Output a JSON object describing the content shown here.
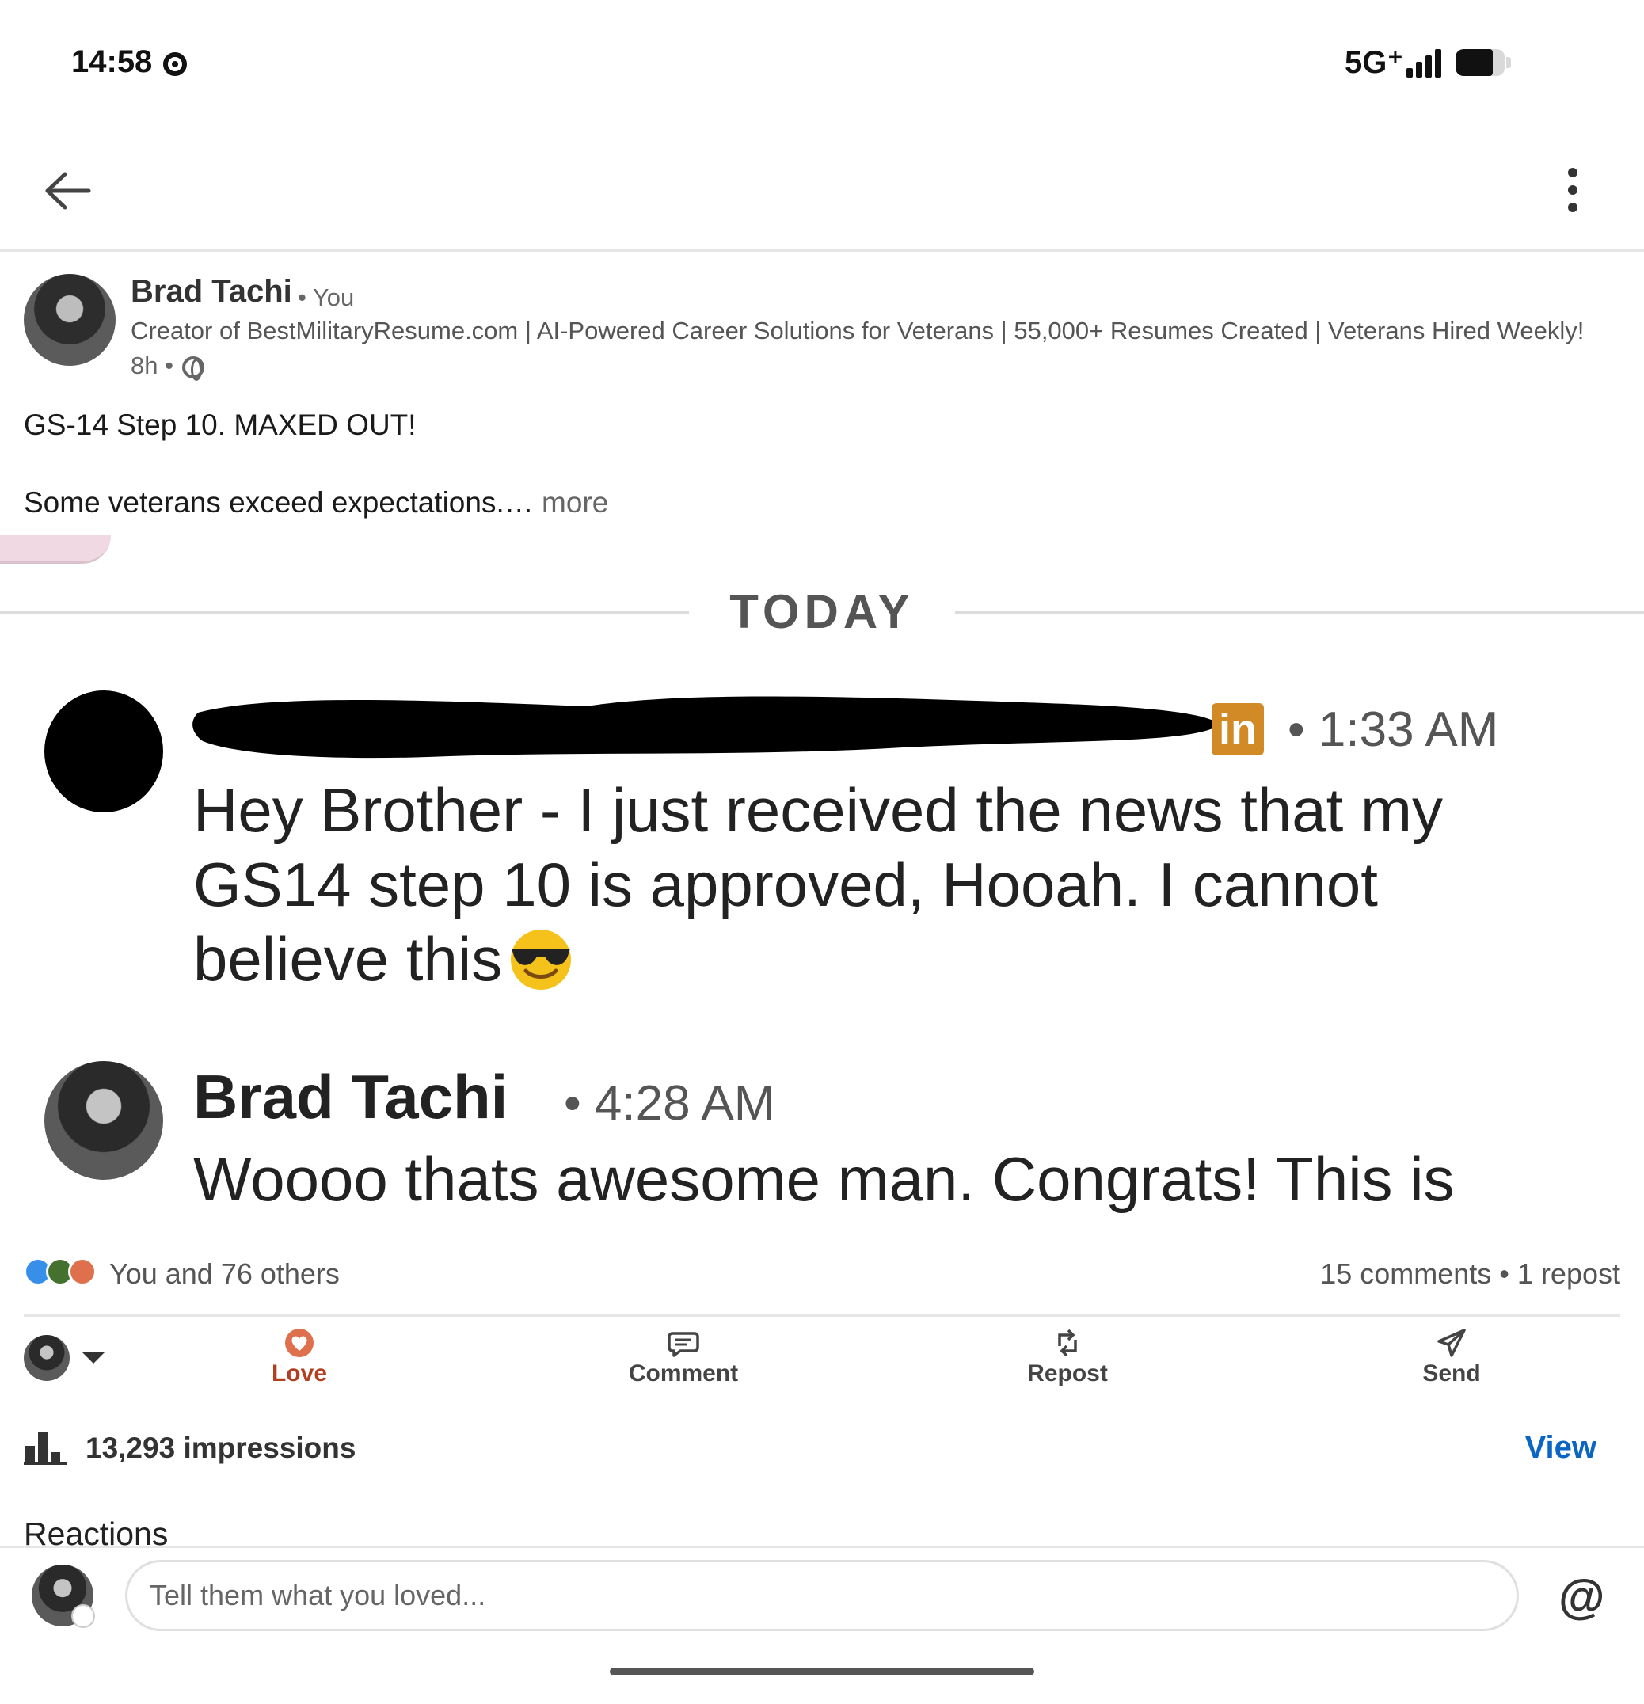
{
  "status_bar": {
    "time": "14:58",
    "network": "5G⁺",
    "battery_level": 0.75
  },
  "app_bar": {
    "back_icon": "arrow-left-icon",
    "more_icon": "vertical-dots-icon"
  },
  "post": {
    "author_name": "Brad Tachi",
    "author_relation": "• You",
    "author_headline": "Creator of BestMilitaryResume.com | AI-Powered Career Solutions for Veterans | 55,000+ Resumes Created | Veterans Hired Weekly!",
    "age": "8h •",
    "visibility_icon": "globe-icon",
    "text_line1": "GS-14 Step 10. MAXED OUT!",
    "text_line2": "Some veterans exceed expectations.…",
    "more_label": " more"
  },
  "embedded_image": {
    "day_label": "TODAY",
    "message1": {
      "badge": "in",
      "time": "• 1:33 AM",
      "text": "Hey Brother - I just received the news that my GS14 step 10 is approved, Hooah. I cannot believe this"
    },
    "message2": {
      "sender": "Brad Tachi",
      "time": "• 4:28 AM",
      "text": "Woooo thats awesome man. Congrats! This is"
    }
  },
  "social": {
    "reactions_summary": "You and 76 others",
    "comments_reposts": "15 comments • 1 repost"
  },
  "actions": [
    {
      "label": "Love",
      "icon": "heart-icon"
    },
    {
      "label": "Comment",
      "icon": "comment-icon"
    },
    {
      "label": "Repost",
      "icon": "repost-icon"
    },
    {
      "label": "Send",
      "icon": "send-icon"
    }
  ],
  "analytics": {
    "impressions": "13,293 impressions",
    "view_label": "View"
  },
  "reactions_heading": "Reactions",
  "composer": {
    "placeholder": "Tell them what you loved...",
    "mention_label": "@"
  },
  "colors": {
    "love": "#b24020",
    "link": "#0a66c2",
    "linkedin_badge": "#d18a25"
  }
}
